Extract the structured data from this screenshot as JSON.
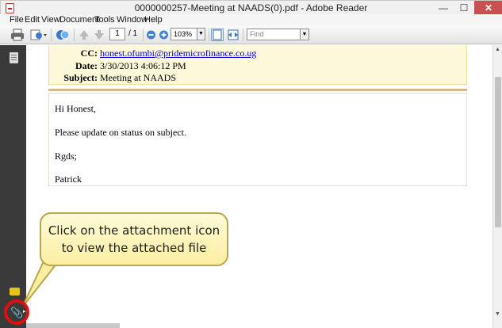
{
  "window": {
    "title": "0000000257-Meeting at NAADS(0).pdf - Adobe Reader",
    "min_glyph": "—",
    "max_glyph": "☐",
    "close_glyph": "✕"
  },
  "menu": [
    "File",
    "Edit",
    "View",
    "Document",
    "Tools",
    "Window",
    "Help"
  ],
  "toolbar": {
    "page_current": "1",
    "page_total": "/ 1",
    "zoom_value": "103%",
    "find_placeholder": "Find",
    "dropdown_glyph": "▼"
  },
  "email_header": {
    "cc_label": "CC:",
    "cc_value": "honest.ofumbi@pridemicrofinance.co.ug",
    "date_label": "Date:",
    "date_value": "3/30/2013 4:06:12 PM",
    "subject_label": "Subject:",
    "subject_value": "Meeting at NAADS"
  },
  "email_body": {
    "greeting": "Hi Honest,",
    "line1": "Please update on status on subject.",
    "signoff": "Rgds;",
    "signature": "Patrick"
  },
  "callout": {
    "line1": "Click on the attachment icon",
    "line2": "to view the attached file"
  },
  "nav_pane": {
    "attachment_glyph": "📎",
    "attachment_arrow": "▸"
  },
  "scrollbar": {
    "up_glyph": "▲",
    "down_glyph": "▼"
  },
  "colors": {
    "callout_border": "#b8a64a",
    "attachment_highlight": "#e01010",
    "header_bg": "#fdf8d9",
    "link": "#0000cc"
  }
}
